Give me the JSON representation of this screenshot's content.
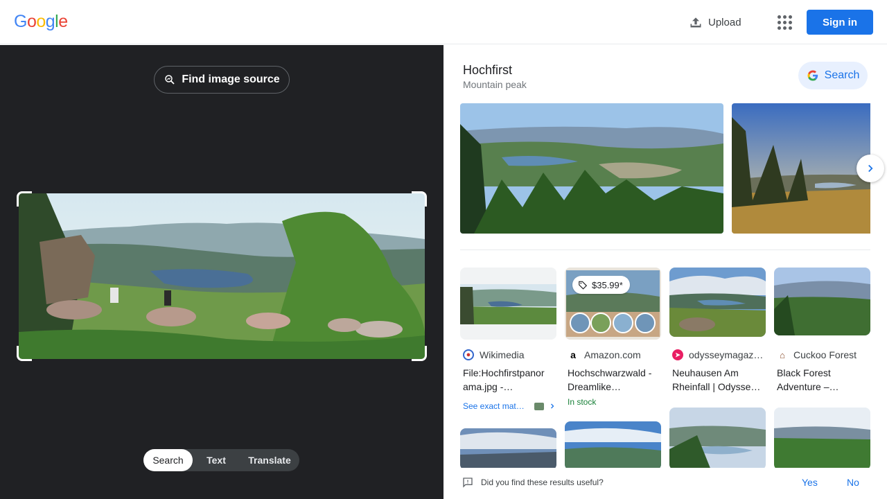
{
  "header": {
    "logo_letters": [
      {
        "ch": "G",
        "color": "#4285F4"
      },
      {
        "ch": "o",
        "color": "#EA4335"
      },
      {
        "ch": "o",
        "color": "#FBBC05"
      },
      {
        "ch": "g",
        "color": "#4285F4"
      },
      {
        "ch": "l",
        "color": "#34A853"
      },
      {
        "ch": "e",
        "color": "#EA4335"
      }
    ],
    "upload_label": "Upload",
    "apps_icon": "apps-grid-icon",
    "signin_label": "Sign in"
  },
  "left": {
    "find_source_label": "Find image source",
    "modes": [
      "Search",
      "Text",
      "Translate"
    ],
    "active_mode": "Search"
  },
  "knowledge": {
    "title": "Hochfirst",
    "subtitle": "Mountain peak",
    "search_label": "Search"
  },
  "results": [
    {
      "source": "Wikimedia",
      "title": "File:Hochfirstpanor ama.jpg -…",
      "extra": "See exact mat…"
    },
    {
      "source": "Amazon.com",
      "title": "Hochschwarzwald - Dreamlike…",
      "price": "$35.99*",
      "extra": "In stock"
    },
    {
      "source": "odysseymagaz…",
      "title": "Neuhausen Am Rheinfall | Odysse…"
    },
    {
      "source": "Cuckoo Forest",
      "title": "Black Forest Adventure –…"
    }
  ],
  "feedback": {
    "question": "Did you find these results useful?",
    "yes": "Yes",
    "no": "No"
  },
  "colors": {
    "accent": "#1a73e8",
    "dark_panel": "#202124",
    "in_stock": "#188038"
  }
}
